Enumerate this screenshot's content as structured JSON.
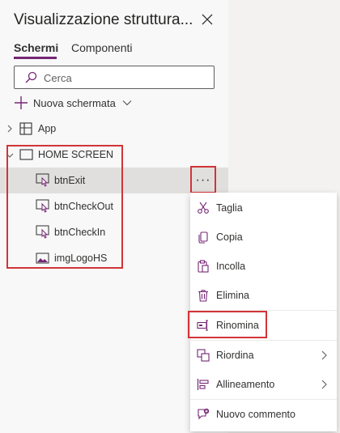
{
  "panel": {
    "title": "Visualizzazione struttura...",
    "tabs": [
      {
        "label": "Schermi",
        "active": true
      },
      {
        "label": "Componenti",
        "active": false
      }
    ],
    "search_placeholder": "Cerca",
    "new_screen_label": "Nuova schermata"
  },
  "tree": {
    "app": "App",
    "screen": "HOME SCREEN",
    "controls": [
      {
        "label": "btnExit",
        "icon": "button-icon",
        "selected": true
      },
      {
        "label": "btnCheckOut",
        "icon": "button-icon"
      },
      {
        "label": "btnCheckIn",
        "icon": "button-icon"
      },
      {
        "label": "imgLogoHS",
        "icon": "image-icon"
      }
    ],
    "more_options": "···"
  },
  "menu": {
    "items": [
      {
        "label": "Taglia",
        "icon": "scissors-icon"
      },
      {
        "label": "Copia",
        "icon": "copy-icon"
      },
      {
        "label": "Incolla",
        "icon": "paste-icon"
      },
      {
        "label": "Elimina",
        "icon": "trash-icon"
      },
      {
        "label": "Rinomina",
        "icon": "rename-icon",
        "highlighted": true
      },
      {
        "label": "Riordina",
        "icon": "reorder-icon",
        "submenu": true
      },
      {
        "label": "Allineamento",
        "icon": "align-icon",
        "submenu": true
      },
      {
        "label": "Nuovo commento",
        "icon": "comment-icon"
      }
    ]
  },
  "colors": {
    "accent": "#742774",
    "highlight": "#d13438",
    "selected_row": "#e1dfdd"
  }
}
